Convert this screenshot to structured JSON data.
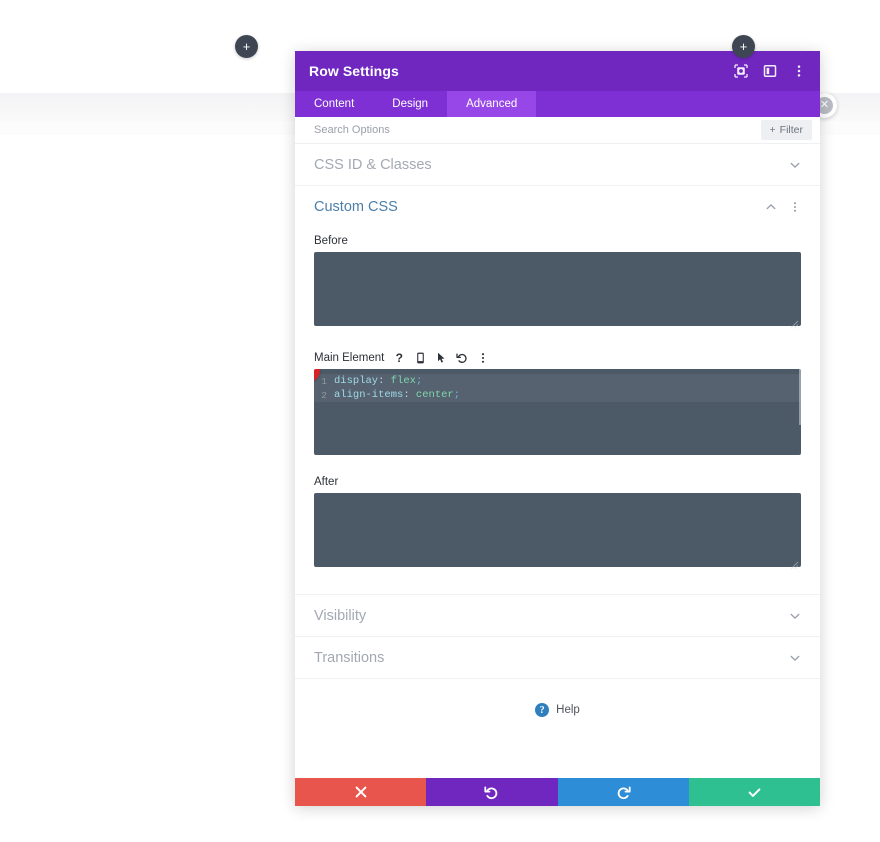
{
  "canvas": {
    "add_button_label": "+",
    "close_button_label": "✕"
  },
  "modal": {
    "title": "Row Settings",
    "header_icons": [
      {
        "name": "focus-target-icon",
        "label": "focus"
      },
      {
        "name": "panel-layout-icon",
        "label": "layout"
      },
      {
        "name": "vertical-dots-icon",
        "label": "more"
      }
    ],
    "tabs": [
      {
        "label": "Content",
        "active": false
      },
      {
        "label": "Design",
        "active": false
      },
      {
        "label": "Advanced",
        "active": true
      }
    ],
    "search": {
      "placeholder": "Search Options",
      "value": ""
    },
    "filter_button": {
      "label": "Filter",
      "icon": "+"
    },
    "sections": [
      {
        "title": "CSS ID & Classes",
        "open": false
      },
      {
        "title": "Custom CSS",
        "open": true
      },
      {
        "title": "Visibility",
        "open": false
      },
      {
        "title": "Transitions",
        "open": false
      }
    ],
    "custom_css": {
      "before": {
        "label": "Before",
        "value": ""
      },
      "main_element": {
        "label": "Main Element",
        "tool_icons": [
          {
            "name": "help-question-icon",
            "glyph": "?"
          },
          {
            "name": "mobile-device-icon",
            "glyph": "device"
          },
          {
            "name": "hover-cursor-icon",
            "glyph": "cursor"
          },
          {
            "name": "reset-undo-icon",
            "glyph": "undo"
          },
          {
            "name": "vertical-dots-icon",
            "glyph": "dots"
          }
        ],
        "badge": "1",
        "code_lines": [
          {
            "number": "1",
            "property": "display",
            "separator": ": ",
            "value": "flex",
            "terminator": ";",
            "highlighted": true
          },
          {
            "number": "2",
            "property": "align-items",
            "separator": ": ",
            "value": "center",
            "terminator": ";",
            "highlighted": true
          }
        ]
      },
      "after": {
        "label": "After",
        "value": ""
      }
    },
    "help": {
      "label": "Help",
      "icon_glyph": "?"
    },
    "footer_buttons": [
      {
        "name": "cancel-button",
        "icon": "close-x-icon",
        "color": "#e8554c"
      },
      {
        "name": "undo-button",
        "icon": "undo-arrow-icon",
        "color": "#7027c0"
      },
      {
        "name": "redo-button",
        "icon": "redo-arrow-icon",
        "color": "#2d8dd6"
      },
      {
        "name": "save-button",
        "icon": "check-icon",
        "color": "#2fc091"
      }
    ]
  },
  "colors": {
    "header_purple": "#7027c0",
    "tab_bar_purple": "#7f30d4",
    "tab_active_purple": "#9747e8",
    "code_bg": "#4c5966",
    "badge_red": "#d8222a",
    "accent_blue": "#4c7fa8"
  }
}
